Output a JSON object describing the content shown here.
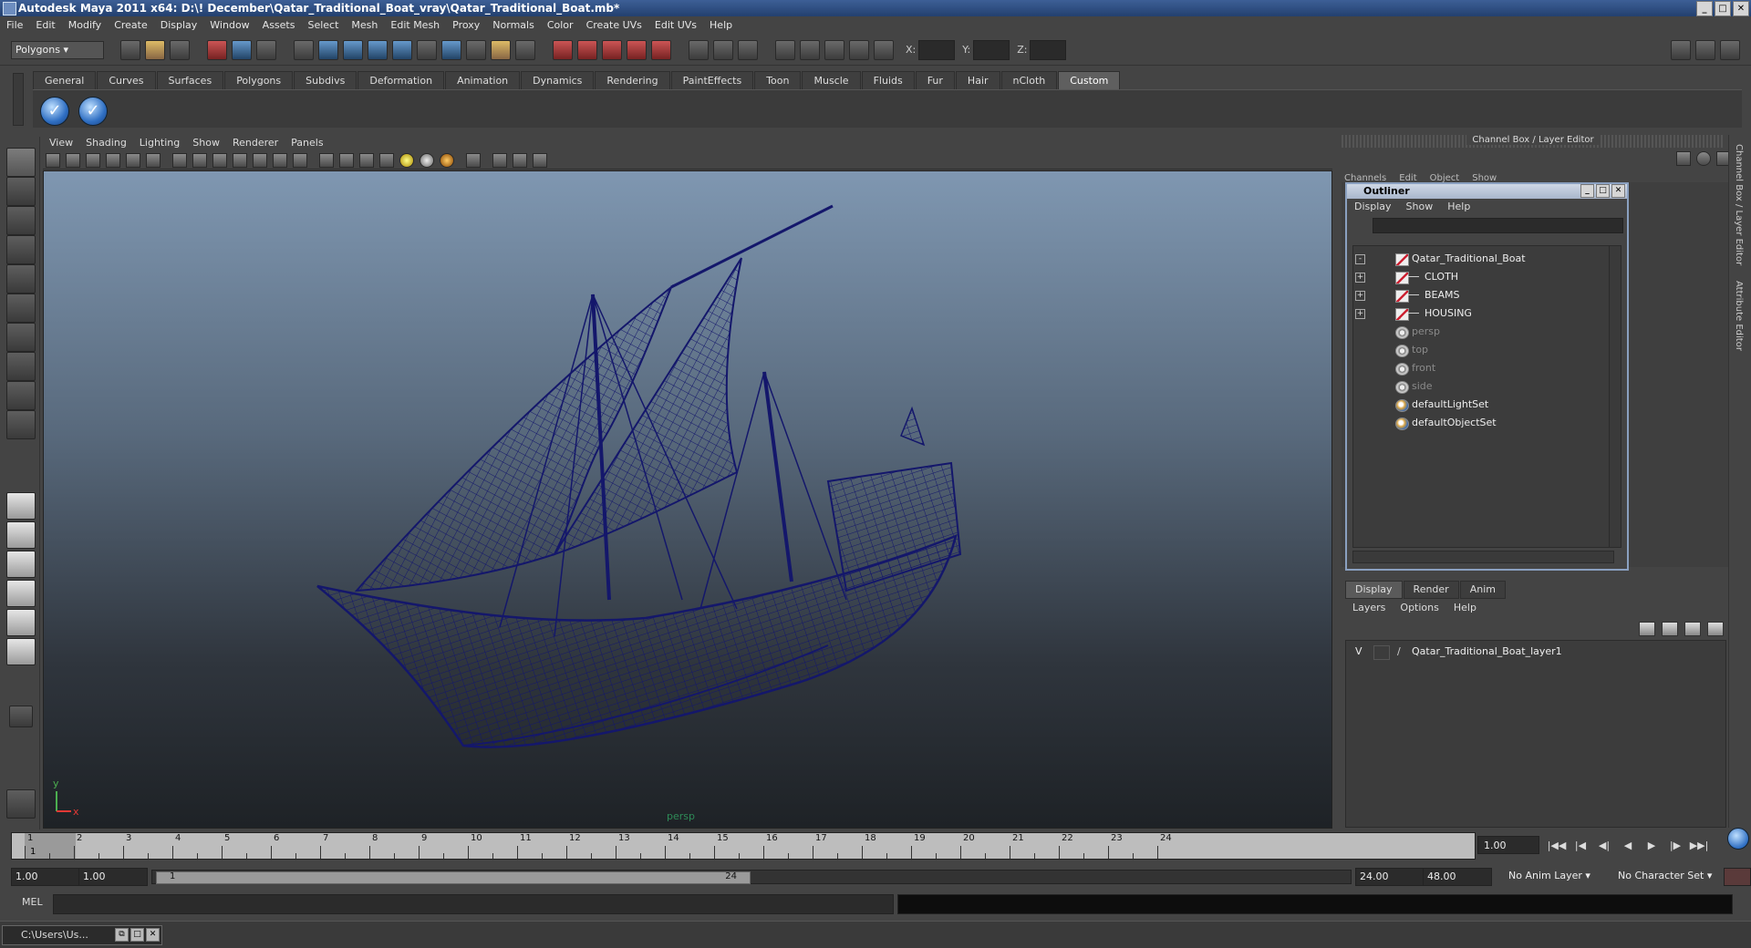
{
  "window": {
    "title": "Autodesk Maya 2011 x64: D:\\! December\\Qatar_Traditional_Boat_vray\\Qatar_Traditional_Boat.mb*",
    "controls": [
      "_",
      "□",
      "✕"
    ]
  },
  "menubar": [
    "File",
    "Edit",
    "Modify",
    "Create",
    "Display",
    "Window",
    "Assets",
    "Select",
    "Mesh",
    "Edit Mesh",
    "Proxy",
    "Normals",
    "Color",
    "Create UVs",
    "Edit UVs",
    "Help"
  ],
  "statusline": {
    "mode": "Polygons",
    "x_label": "X:",
    "y_label": "Y:",
    "z_label": "Z:"
  },
  "shelf": {
    "tabs": [
      "General",
      "Curves",
      "Surfaces",
      "Polygons",
      "Subdivs",
      "Deformation",
      "Animation",
      "Dynamics",
      "Rendering",
      "PaintEffects",
      "Toon",
      "Muscle",
      "Fluids",
      "Fur",
      "Hair",
      "nCloth",
      "Custom"
    ],
    "active_tab": "Custom",
    "icons": [
      "check-icon",
      "check-icon"
    ]
  },
  "viewport": {
    "menu": [
      "View",
      "Shading",
      "Lighting",
      "Show",
      "Renderer",
      "Panels"
    ],
    "camera_label": "persp",
    "axis_y": "y",
    "axis_x": "x",
    "wire_color": "#14176b"
  },
  "channelbox": {
    "header": "Channel Box / Layer Editor",
    "menu": [
      "Channels",
      "Edit",
      "Object",
      "Show"
    ],
    "side_tabs": [
      "Channel Box / Layer Editor",
      "Attribute Editor"
    ]
  },
  "outliner": {
    "title": "Outliner",
    "menu": [
      "Display",
      "Show",
      "Help"
    ],
    "items": [
      {
        "name": "Qatar_Traditional_Boat",
        "type": "transform",
        "expand": "-",
        "indent": 0,
        "dim": false
      },
      {
        "name": "CLOTH",
        "type": "transform",
        "expand": "+",
        "indent": 1,
        "dim": false
      },
      {
        "name": "BEAMS",
        "type": "transform",
        "expand": "+",
        "indent": 1,
        "dim": false
      },
      {
        "name": "HOUSING",
        "type": "transform",
        "expand": "+",
        "indent": 1,
        "dim": false
      },
      {
        "name": "persp",
        "type": "camera",
        "expand": "",
        "indent": 0,
        "dim": true
      },
      {
        "name": "top",
        "type": "camera",
        "expand": "",
        "indent": 0,
        "dim": true
      },
      {
        "name": "front",
        "type": "camera",
        "expand": "",
        "indent": 0,
        "dim": true
      },
      {
        "name": "side",
        "type": "camera",
        "expand": "",
        "indent": 0,
        "dim": true
      },
      {
        "name": "defaultLightSet",
        "type": "set",
        "expand": "",
        "indent": 0,
        "dim": false
      },
      {
        "name": "defaultObjectSet",
        "type": "set",
        "expand": "",
        "indent": 0,
        "dim": false
      }
    ]
  },
  "layer_editor": {
    "tabs": [
      "Display",
      "Render",
      "Anim"
    ],
    "active_tab": "Display",
    "menu": [
      "Layers",
      "Options",
      "Help"
    ],
    "layers": [
      {
        "visible": "V",
        "name": "Qatar_Traditional_Boat_layer1"
      }
    ]
  },
  "timeline": {
    "ticks": [
      "1",
      "2",
      "3",
      "4",
      "5",
      "6",
      "7",
      "8",
      "9",
      "10",
      "11",
      "12",
      "13",
      "14",
      "15",
      "16",
      "17",
      "18",
      "19",
      "20",
      "21",
      "22",
      "23",
      "24"
    ],
    "current_frame": "1",
    "current_time": "1.00",
    "playback_buttons": [
      "|◀◀",
      "|◀",
      "◀|",
      "◀",
      "▶",
      "|▶",
      "▶▶|"
    ]
  },
  "range": {
    "start_time": "1.00",
    "range_start": "1.00",
    "handle_start": "1",
    "handle_end": "24",
    "range_end": "24.00",
    "end_time": "48.00",
    "anim_layer": "No Anim Layer",
    "character_set": "No Character Set"
  },
  "command": {
    "label": "MEL"
  },
  "taskbar": {
    "item": "C:\\Users\\Us...",
    "controls": [
      "⧉",
      "□",
      "✕"
    ]
  }
}
